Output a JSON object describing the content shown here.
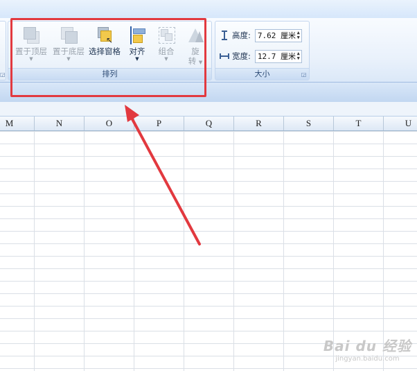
{
  "ribbon": {
    "arrange_group": {
      "label": "排列",
      "buttons": [
        {
          "label": "置于顶层",
          "state": "disabled",
          "has_dropdown": true,
          "icon": "bring-to-front-icon"
        },
        {
          "label": "置于底层",
          "state": "disabled",
          "has_dropdown": true,
          "icon": "send-to-back-icon"
        },
        {
          "label": "选择窗格",
          "state": "enabled",
          "has_dropdown": false,
          "icon": "selection-pane-icon"
        },
        {
          "label": "对齐",
          "state": "enabled",
          "has_dropdown": true,
          "icon": "align-icon"
        },
        {
          "label": "组合",
          "state": "disabled",
          "has_dropdown": true,
          "icon": "group-icon"
        },
        {
          "label": "旋转",
          "label_line1": "旋",
          "label_line2": "转",
          "state": "disabled",
          "has_dropdown": true,
          "icon": "rotate-icon"
        }
      ]
    },
    "size_group": {
      "label": "大小",
      "height_label": "高度:",
      "height_value": "7.62 厘米",
      "width_label": "宽度:",
      "width_value": "12.7 厘米"
    }
  },
  "columns": [
    "M",
    "N",
    "O",
    "P",
    "Q",
    "R",
    "S",
    "T",
    "U"
  ],
  "annotation": {
    "color": "#e2393f"
  },
  "watermark": {
    "text": "Bai du 经验",
    "url": "jingyan.baidu.com"
  }
}
